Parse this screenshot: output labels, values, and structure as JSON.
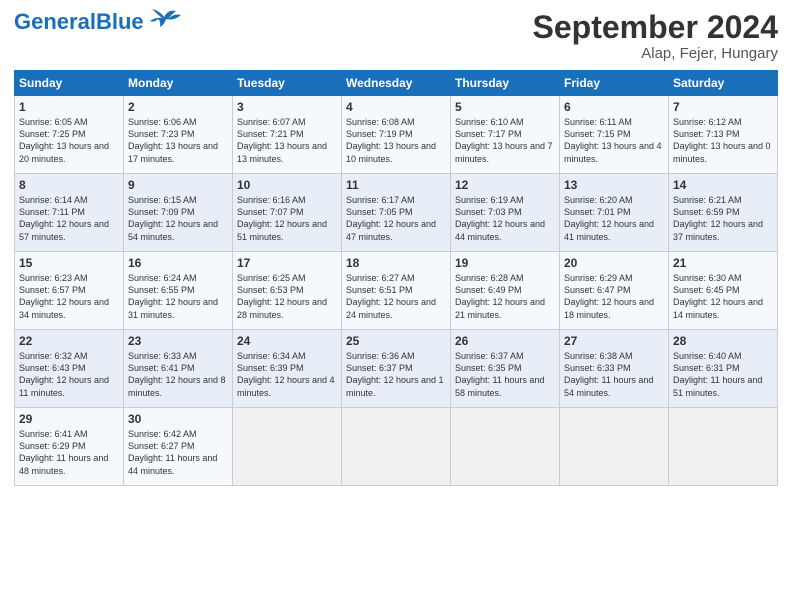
{
  "logo": {
    "part1": "General",
    "part2": "Blue"
  },
  "title": "September 2024",
  "subtitle": "Alap, Fejer, Hungary",
  "headers": [
    "Sunday",
    "Monday",
    "Tuesday",
    "Wednesday",
    "Thursday",
    "Friday",
    "Saturday"
  ],
  "weeks": [
    [
      {
        "day": "1",
        "sunrise": "6:05 AM",
        "sunset": "7:25 PM",
        "daylight": "13 hours and 20 minutes."
      },
      {
        "day": "2",
        "sunrise": "6:06 AM",
        "sunset": "7:23 PM",
        "daylight": "13 hours and 17 minutes."
      },
      {
        "day": "3",
        "sunrise": "6:07 AM",
        "sunset": "7:21 PM",
        "daylight": "13 hours and 13 minutes."
      },
      {
        "day": "4",
        "sunrise": "6:08 AM",
        "sunset": "7:19 PM",
        "daylight": "13 hours and 10 minutes."
      },
      {
        "day": "5",
        "sunrise": "6:10 AM",
        "sunset": "7:17 PM",
        "daylight": "13 hours and 7 minutes."
      },
      {
        "day": "6",
        "sunrise": "6:11 AM",
        "sunset": "7:15 PM",
        "daylight": "13 hours and 4 minutes."
      },
      {
        "day": "7",
        "sunrise": "6:12 AM",
        "sunset": "7:13 PM",
        "daylight": "13 hours and 0 minutes."
      }
    ],
    [
      {
        "day": "8",
        "sunrise": "6:14 AM",
        "sunset": "7:11 PM",
        "daylight": "12 hours and 57 minutes."
      },
      {
        "day": "9",
        "sunrise": "6:15 AM",
        "sunset": "7:09 PM",
        "daylight": "12 hours and 54 minutes."
      },
      {
        "day": "10",
        "sunrise": "6:16 AM",
        "sunset": "7:07 PM",
        "daylight": "12 hours and 51 minutes."
      },
      {
        "day": "11",
        "sunrise": "6:17 AM",
        "sunset": "7:05 PM",
        "daylight": "12 hours and 47 minutes."
      },
      {
        "day": "12",
        "sunrise": "6:19 AM",
        "sunset": "7:03 PM",
        "daylight": "12 hours and 44 minutes."
      },
      {
        "day": "13",
        "sunrise": "6:20 AM",
        "sunset": "7:01 PM",
        "daylight": "12 hours and 41 minutes."
      },
      {
        "day": "14",
        "sunrise": "6:21 AM",
        "sunset": "6:59 PM",
        "daylight": "12 hours and 37 minutes."
      }
    ],
    [
      {
        "day": "15",
        "sunrise": "6:23 AM",
        "sunset": "6:57 PM",
        "daylight": "12 hours and 34 minutes."
      },
      {
        "day": "16",
        "sunrise": "6:24 AM",
        "sunset": "6:55 PM",
        "daylight": "12 hours and 31 minutes."
      },
      {
        "day": "17",
        "sunrise": "6:25 AM",
        "sunset": "6:53 PM",
        "daylight": "12 hours and 28 minutes."
      },
      {
        "day": "18",
        "sunrise": "6:27 AM",
        "sunset": "6:51 PM",
        "daylight": "12 hours and 24 minutes."
      },
      {
        "day": "19",
        "sunrise": "6:28 AM",
        "sunset": "6:49 PM",
        "daylight": "12 hours and 21 minutes."
      },
      {
        "day": "20",
        "sunrise": "6:29 AM",
        "sunset": "6:47 PM",
        "daylight": "12 hours and 18 minutes."
      },
      {
        "day": "21",
        "sunrise": "6:30 AM",
        "sunset": "6:45 PM",
        "daylight": "12 hours and 14 minutes."
      }
    ],
    [
      {
        "day": "22",
        "sunrise": "6:32 AM",
        "sunset": "6:43 PM",
        "daylight": "12 hours and 11 minutes."
      },
      {
        "day": "23",
        "sunrise": "6:33 AM",
        "sunset": "6:41 PM",
        "daylight": "12 hours and 8 minutes."
      },
      {
        "day": "24",
        "sunrise": "6:34 AM",
        "sunset": "6:39 PM",
        "daylight": "12 hours and 4 minutes."
      },
      {
        "day": "25",
        "sunrise": "6:36 AM",
        "sunset": "6:37 PM",
        "daylight": "12 hours and 1 minute."
      },
      {
        "day": "26",
        "sunrise": "6:37 AM",
        "sunset": "6:35 PM",
        "daylight": "11 hours and 58 minutes."
      },
      {
        "day": "27",
        "sunrise": "6:38 AM",
        "sunset": "6:33 PM",
        "daylight": "11 hours and 54 minutes."
      },
      {
        "day": "28",
        "sunrise": "6:40 AM",
        "sunset": "6:31 PM",
        "daylight": "11 hours and 51 minutes."
      }
    ],
    [
      {
        "day": "29",
        "sunrise": "6:41 AM",
        "sunset": "6:29 PM",
        "daylight": "11 hours and 48 minutes."
      },
      {
        "day": "30",
        "sunrise": "6:42 AM",
        "sunset": "6:27 PM",
        "daylight": "11 hours and 44 minutes."
      },
      null,
      null,
      null,
      null,
      null
    ]
  ]
}
